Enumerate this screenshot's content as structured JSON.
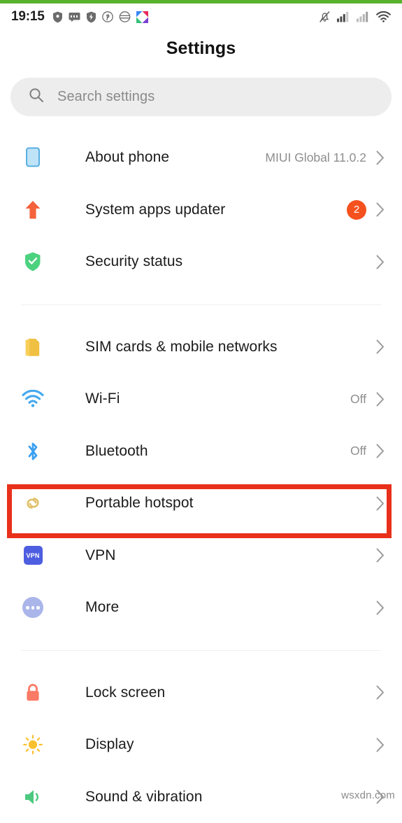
{
  "status_bar": {
    "clock": "19:15",
    "left_icons": [
      "shield-icon",
      "message-icon",
      "shield-bolt-icon",
      "pinterest-icon",
      "hamburger-bun-icon",
      "app-logo-icon"
    ],
    "right_icons": [
      "mute-bell-icon",
      "signal-bars-icon-1",
      "signal-bars-icon-2",
      "wifi-icon"
    ]
  },
  "header": {
    "title": "Settings"
  },
  "search": {
    "placeholder": "Search settings",
    "icon": "search-icon"
  },
  "groups": [
    {
      "items": [
        {
          "label": "About phone",
          "value": "MIUI Global 11.0.2",
          "icon": "phone-icon",
          "icon_color": "#9fd4f2",
          "badge": null,
          "highlighted": false
        },
        {
          "label": "System apps updater",
          "value": "",
          "icon": "up-arrow-icon",
          "icon_color": "#f4623c",
          "badge": "2",
          "highlighted": false
        },
        {
          "label": "Security status",
          "value": "",
          "icon": "shield-check-icon",
          "icon_color": "#4cd27f",
          "badge": null,
          "highlighted": false
        }
      ]
    },
    {
      "items": [
        {
          "label": "SIM cards & mobile networks",
          "value": "",
          "icon": "sim-card-icon",
          "icon_color": "#f7c94b",
          "badge": null,
          "highlighted": false
        },
        {
          "label": "Wi-Fi",
          "value": "Off",
          "icon": "wifi-icon",
          "icon_color": "#44a8ee",
          "badge": null,
          "highlighted": false
        },
        {
          "label": "Bluetooth",
          "value": "Off",
          "icon": "bluetooth-icon",
          "icon_color": "#3aa0ef",
          "badge": null,
          "highlighted": false
        },
        {
          "label": "Portable hotspot",
          "value": "",
          "icon": "hotspot-icon",
          "icon_color": "#e0c068",
          "badge": null,
          "highlighted": true
        },
        {
          "label": "VPN",
          "value": "",
          "icon": "vpn-icon",
          "icon_color": "#4e5ee0",
          "badge": null,
          "highlighted": false
        },
        {
          "label": "More",
          "value": "",
          "icon": "more-dots-icon",
          "icon_color": "#aab6ea",
          "badge": null,
          "highlighted": false
        }
      ]
    },
    {
      "items": [
        {
          "label": "Lock screen",
          "value": "",
          "icon": "lock-icon",
          "icon_color": "#f97a65",
          "badge": null,
          "highlighted": false
        },
        {
          "label": "Display",
          "value": "",
          "icon": "sun-icon",
          "icon_color": "#fbc02d",
          "badge": null,
          "highlighted": false
        },
        {
          "label": "Sound & vibration",
          "value": "",
          "icon": "sound-icon",
          "icon_color": "#4cc97f",
          "badge": null,
          "highlighted": false
        }
      ]
    }
  ],
  "highlight": {
    "target": "Portable hotspot",
    "color": "#e8301a"
  },
  "watermark": "wsxdn.com",
  "colors": {
    "progress_bar": "#58b22c",
    "badge": "#f4511e",
    "search_bg": "#ededed",
    "chevron": "#9a9a9a",
    "label": "#1b1b1b",
    "value": "#8e8e8e"
  }
}
